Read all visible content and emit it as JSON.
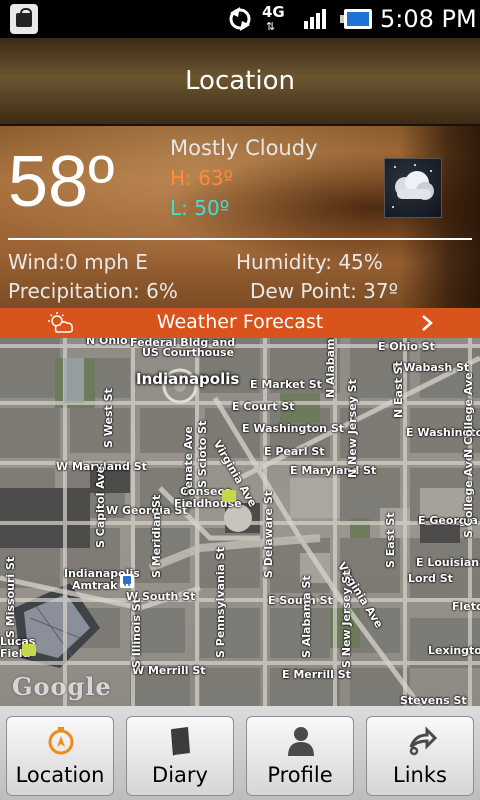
{
  "status_bar": {
    "network": "4G",
    "time": "5:08 PM"
  },
  "title": "Location",
  "weather": {
    "temperature": "58º",
    "condition": "Mostly Cloudy",
    "high": "H: 63º",
    "low": "L: 50º",
    "wind": "Wind:0 mph E",
    "humidity": "Humidity: 45%",
    "precipitation": "Precipitation: 6%",
    "dew_point": "Dew Point: 37º"
  },
  "forecast_bar": {
    "label": "Weather Forecast"
  },
  "map": {
    "city": "Indianapolis",
    "attribution": "Google",
    "streets": [
      "Federal Bldg and",
      "US Courthouse",
      "E Ohio St",
      "E Wabash St",
      "E Market St",
      "E Court St",
      "E Washington St",
      "E Washington St",
      "E Pearl St",
      "E Maryland St",
      "W Maryland St",
      "W Georgia St",
      "E Georgia St",
      "E Louisiana St",
      "Lord St",
      "W South St",
      "E South St",
      "W Merrill St",
      "E Merrill St",
      "Lexington Ave",
      "Virginia Ave",
      "Virginia Ave",
      "Fletcher",
      "S Capitol Ave",
      "S Illinois St",
      "S Meridian St",
      "S Pennsylvania St",
      "S Delaware St",
      "S Alabama St",
      "S New Jersey St",
      "S East St",
      "S College Ave",
      "S Missouri St",
      "N New Jersey St",
      "N East St",
      "N College Ave",
      "N Alabama St",
      "S Senate Ave",
      "S Scioto St",
      "S West St",
      "Stevens St",
      "N Ohio"
    ],
    "places": [
      "Conseco",
      "Fieldhouse",
      "Indianapolis",
      "Amtrak",
      "Lucas",
      "Field"
    ]
  },
  "nav": [
    {
      "label": "Location",
      "icon": "compass-icon"
    },
    {
      "label": "Diary",
      "icon": "book-icon"
    },
    {
      "label": "Profile",
      "icon": "person-icon"
    },
    {
      "label": "Links",
      "icon": "share-icon"
    }
  ]
}
